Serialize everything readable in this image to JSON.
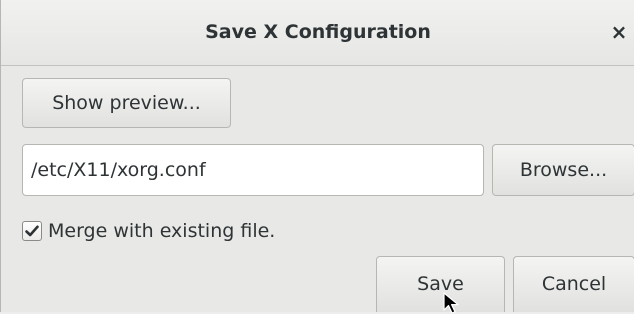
{
  "dialog": {
    "title": "Save X Configuration",
    "close_glyph": "×",
    "show_preview_label": "Show preview...",
    "path_value": "/etc/X11/xorg.conf",
    "browse_label": "Browse...",
    "merge_checked": true,
    "merge_label": "Merge with existing file.",
    "save_label": "Save",
    "cancel_label": "Cancel"
  },
  "icons": {
    "close": "close-icon",
    "check": "checkmark-icon",
    "pointer": "mouse-pointer-icon"
  },
  "colors": {
    "background": "#e8e8e7",
    "text": "#2e3436",
    "border": "#b6b6b3",
    "entry_bg": "#ffffff"
  }
}
